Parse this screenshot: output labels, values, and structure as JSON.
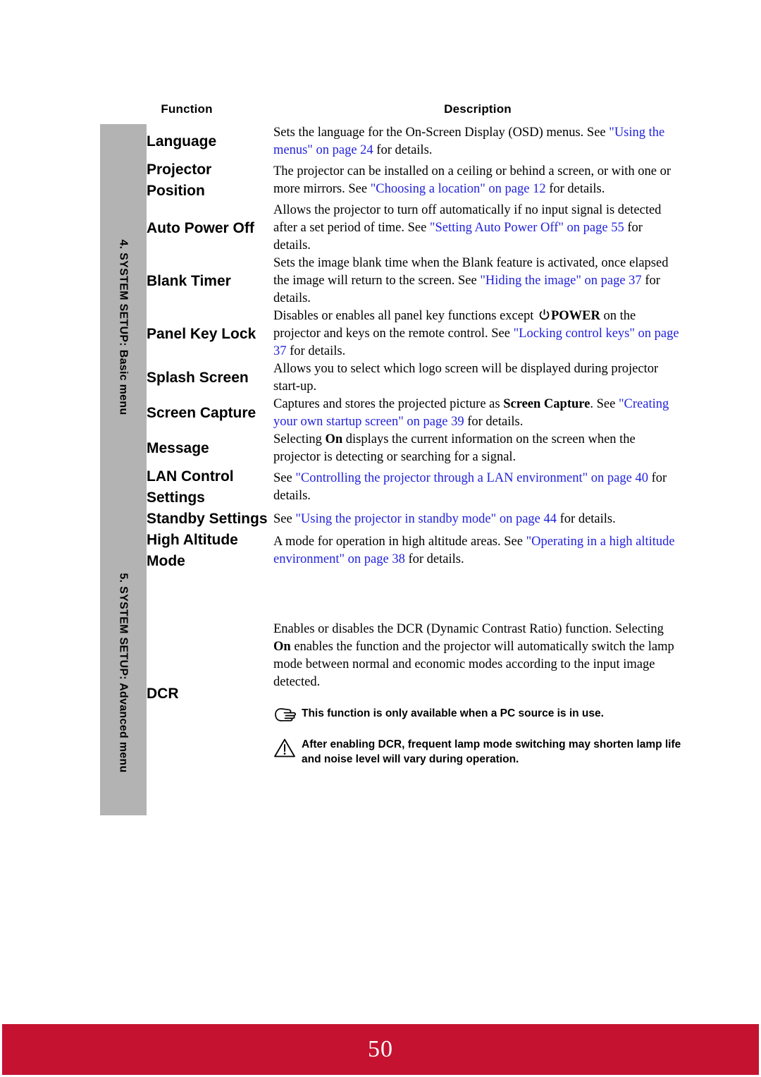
{
  "page": {
    "page_number": "50",
    "footer_color": "#c41230",
    "sidebar_color": "#b3b3b3",
    "link_color": "#2222dd"
  },
  "table": {
    "headers": {
      "function": "Function",
      "description": "Description"
    },
    "sections": [
      {
        "id": "basic",
        "label": "4. SYSTEM SETUP: Basic menu"
      },
      {
        "id": "advanced",
        "label": "5. SYSTEM SETUP: Advanced menu"
      }
    ],
    "rows": [
      {
        "function": "Language",
        "desc_parts": [
          {
            "t": "Sets the language for the On-Screen Display (OSD) menus. See ",
            "s": "plain"
          },
          {
            "t": "\"Using the menus\" on page 24",
            "s": "link"
          },
          {
            "t": " for details.",
            "s": "plain"
          }
        ]
      },
      {
        "function": "Projector Position",
        "desc_parts": [
          {
            "t": "The projector can be installed on a ceiling or behind a screen, or with one or more mirrors. See ",
            "s": "plain"
          },
          {
            "t": "\"Choosing a location\" on page 12",
            "s": "link"
          },
          {
            "t": " for details.",
            "s": "plain"
          }
        ]
      },
      {
        "function": "Auto Power Off",
        "desc_parts": [
          {
            "t": "Allows the projector to turn off automatically if no input signal is detected after a set period of time. See ",
            "s": "plain"
          },
          {
            "t": "\"Setting Auto Power Off\" on page 55",
            "s": "link"
          },
          {
            "t": " for details.",
            "s": "plain"
          }
        ]
      },
      {
        "function": "Blank Timer",
        "desc_parts": [
          {
            "t": "Sets the image blank time when the Blank feature is activated, once elapsed the image will return to the screen. See ",
            "s": "plain"
          },
          {
            "t": "\"Hiding the image\" on page 37",
            "s": "link"
          },
          {
            "t": " for details.",
            "s": "plain"
          }
        ]
      },
      {
        "function": "Panel Key Lock",
        "desc_parts": [
          {
            "t": "Disables or enables all panel key functions except ",
            "s": "plain"
          },
          {
            "t": "power-icon",
            "s": "icon"
          },
          {
            "t": "POWER",
            "s": "bold"
          },
          {
            "t": " on the projector and keys on the remote control. See ",
            "s": "plain"
          },
          {
            "t": "\"Locking control keys\" on page 37",
            "s": "link"
          },
          {
            "t": " for details.",
            "s": "plain"
          }
        ]
      },
      {
        "function": "Splash Screen",
        "desc_parts": [
          {
            "t": "Allows you to select which logo screen will be displayed during projector start-up.",
            "s": "plain"
          }
        ]
      },
      {
        "function": "Screen Capture",
        "desc_parts": [
          {
            "t": "Captures and stores the projected picture as ",
            "s": "plain"
          },
          {
            "t": "Screen Capture",
            "s": "bold"
          },
          {
            "t": ". See ",
            "s": "plain"
          },
          {
            "t": "\"Creating your own startup screen\" on page 39",
            "s": "link"
          },
          {
            "t": " for details.",
            "s": "plain"
          }
        ]
      },
      {
        "function": "Message",
        "desc_parts": [
          {
            "t": "Selecting ",
            "s": "plain"
          },
          {
            "t": "On",
            "s": "bold"
          },
          {
            "t": " displays the current information on the screen when the projector is detecting or searching for a signal.",
            "s": "plain"
          }
        ]
      },
      {
        "function": "LAN Control Settings",
        "desc_parts": [
          {
            "t": "See ",
            "s": "plain"
          },
          {
            "t": "\"Controlling the projector through a LAN environment\" on page 40",
            "s": "link"
          },
          {
            "t": " for details.",
            "s": "plain"
          }
        ]
      },
      {
        "function": "Standby Settings",
        "desc_parts": [
          {
            "t": "See ",
            "s": "plain"
          },
          {
            "t": "\"Using the projector in standby mode\" on page 44",
            "s": "link"
          },
          {
            "t": " for details.",
            "s": "plain"
          }
        ]
      },
      {
        "function": "High Altitude Mode",
        "desc_parts": [
          {
            "t": "A mode for operation in high altitude areas. See ",
            "s": "plain"
          },
          {
            "t": "\"Operating in a high altitude environment\" on page 38",
            "s": "link"
          },
          {
            "t": " for details.",
            "s": "plain"
          }
        ]
      },
      {
        "function": "DCR",
        "desc_parts": [
          {
            "t": "Enables or disables the DCR (Dynamic Contrast Ratio) function. Selecting ",
            "s": "plain"
          },
          {
            "t": "On",
            "s": "bold"
          },
          {
            "t": " enables the function and the projector will automatically switch the lamp mode between normal and economic modes according to the input image detected.",
            "s": "plain"
          }
        ],
        "notes": [
          {
            "icon": "pointing-hand-icon",
            "text": "This function is only available when a PC source is in use."
          },
          {
            "icon": "warning-triangle-icon",
            "text": "After enabling DCR, frequent lamp mode switching may shorten lamp life and noise level will vary during operation."
          }
        ]
      }
    ]
  }
}
